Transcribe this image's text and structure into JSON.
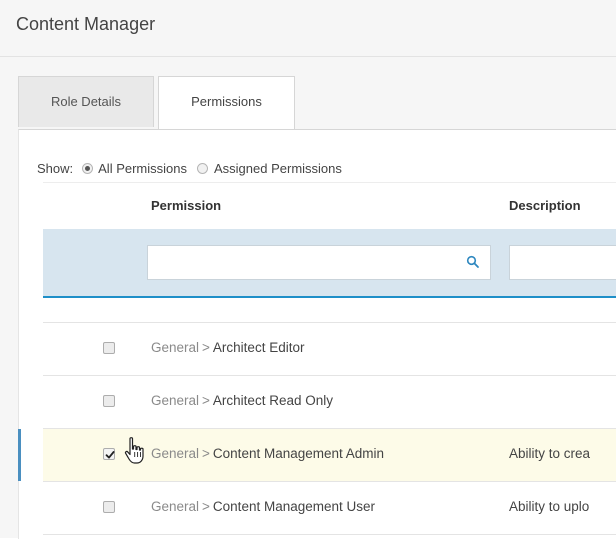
{
  "header": {
    "title": "Content Manager"
  },
  "tabs": [
    {
      "label": "Role Details",
      "active": false
    },
    {
      "label": "Permissions",
      "active": true
    }
  ],
  "filter": {
    "show_label": "Show:",
    "options": [
      {
        "label": "All Permissions",
        "checked": true
      },
      {
        "label": "Assigned Permissions",
        "checked": false
      }
    ]
  },
  "table": {
    "columns": [
      "Permission",
      "Description"
    ],
    "search_placeholders": {
      "permission": "",
      "description": ""
    },
    "rows": [
      {
        "category": "General",
        "separator": ">",
        "name": "Architect Editor",
        "description": "",
        "checked": false,
        "selected": false
      },
      {
        "category": "General",
        "separator": ">",
        "name": "Architect Read Only",
        "description": "",
        "checked": false,
        "selected": false
      },
      {
        "category": "General",
        "separator": ">",
        "name": "Content Management Admin",
        "description": "Ability to crea",
        "checked": true,
        "selected": true
      },
      {
        "category": "General",
        "separator": ">",
        "name": "Content Management User",
        "description": "Ability to uplo",
        "checked": false,
        "selected": false
      }
    ]
  },
  "colors": {
    "accent": "#1e8fc8",
    "filter_band": "#d7e5ef",
    "selected_row": "#fdfbe8"
  },
  "icons": {
    "search": "search-icon",
    "cursor": "hand-pointer-icon"
  }
}
